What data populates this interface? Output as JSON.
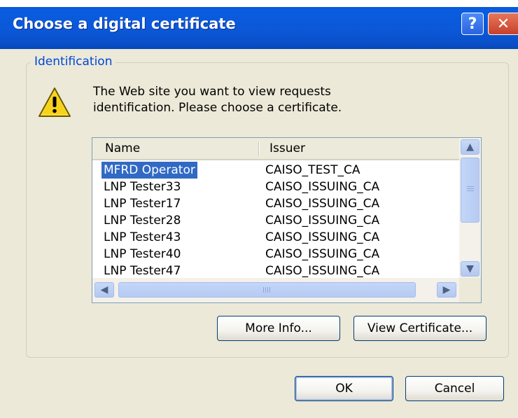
{
  "window": {
    "title": "Choose a digital certificate",
    "help_label": "?",
    "close_label": "✕"
  },
  "group": {
    "legend": "Identification",
    "message_line1": "The Web site you want to view requests",
    "message_line2": "identification. Please choose a certificate."
  },
  "list": {
    "columns": {
      "name": "Name",
      "issuer": "Issuer"
    },
    "rows": [
      {
        "name": "MFRD Operator",
        "issuer": "CAISO_TEST_CA",
        "selected": true
      },
      {
        "name": "LNP Tester33",
        "issuer": "CAISO_ISSUING_CA"
      },
      {
        "name": "LNP Tester17",
        "issuer": "CAISO_ISSUING_CA"
      },
      {
        "name": "LNP Tester28",
        "issuer": "CAISO_ISSUING_CA"
      },
      {
        "name": "LNP Tester43",
        "issuer": "CAISO_ISSUING_CA"
      },
      {
        "name": "LNP Tester40",
        "issuer": "CAISO_ISSUING_CA"
      },
      {
        "name": "LNP Tester47",
        "issuer": "CAISO_ISSUING_CA"
      }
    ]
  },
  "buttons": {
    "more_info": "More Info...",
    "view_certificate": "View Certificate...",
    "ok": "OK",
    "cancel": "Cancel"
  },
  "icons": {
    "warning": "warning-icon",
    "scroll_up": "chevron-up-icon",
    "scroll_down": "chevron-down-icon",
    "scroll_left": "chevron-left-icon",
    "scroll_right": "chevron-right-icon"
  },
  "colors": {
    "titlebar": "#0a5ce0",
    "dialog_bg": "#ece9d8",
    "legend_text": "#0046d5",
    "selection": "#316ac5"
  }
}
